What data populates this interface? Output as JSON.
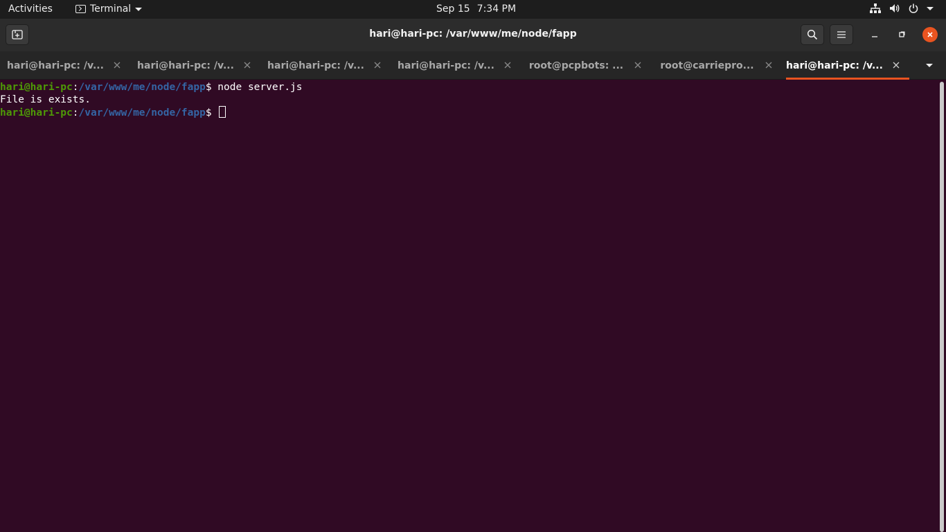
{
  "topbar": {
    "activities": "Activities",
    "app_name": "Terminal",
    "date": "Sep 15",
    "time": "7:34 PM",
    "icons": [
      "network-icon",
      "volume-icon",
      "power-icon",
      "system-menu-caret-icon"
    ]
  },
  "window": {
    "title": "hari@hari-pc: /var/www/me/node/fapp",
    "close_color": "#e95420"
  },
  "tabs": [
    {
      "label": "hari@hari-pc: /v...",
      "active": false
    },
    {
      "label": "hari@hari-pc: /v...",
      "active": false
    },
    {
      "label": "hari@hari-pc: /v...",
      "active": false
    },
    {
      "label": "hari@hari-pc: /v...",
      "active": false
    },
    {
      "label": "root@pcpbots: ...",
      "active": false
    },
    {
      "label": "root@carriepro...",
      "active": false
    },
    {
      "label": "hari@hari-pc: /v...",
      "active": true
    }
  ],
  "terminal": {
    "background": "#300a24",
    "user_host": "hari@hari-pc",
    "path": "/var/www/me/node/fapp",
    "separator": ":",
    "prompt_symbol": "$ ",
    "command": "node server.js",
    "output": "File is exists."
  }
}
